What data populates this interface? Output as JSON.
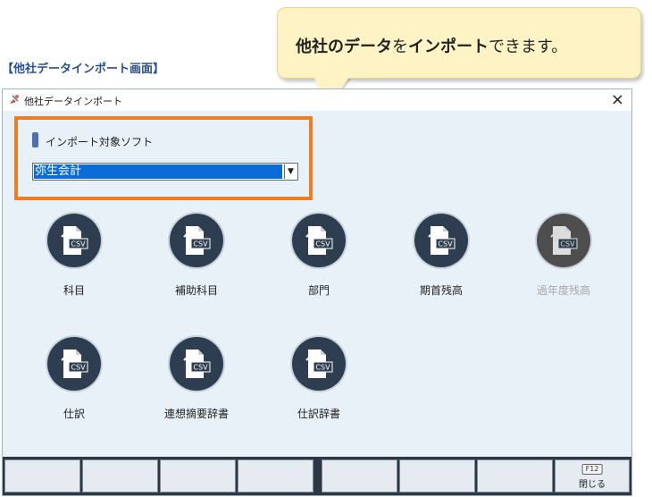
{
  "caption": "【他社データインポート画面】",
  "callout": {
    "bold1": "他社のデータ",
    "plain1": "を",
    "bold2": "インポート",
    "plain2": "できます。"
  },
  "window": {
    "title": "他社データインポート",
    "close": "×"
  },
  "soft": {
    "label": "インポート対象ソフト",
    "value": "弥生会計",
    "dropdown_icon": "▼"
  },
  "tiles": [
    {
      "label": "科目",
      "icon": "csv-file-icon",
      "enabled": true
    },
    {
      "label": "補助科目",
      "icon": "csv-file-icon",
      "enabled": true
    },
    {
      "label": "部門",
      "icon": "csv-file-icon",
      "enabled": true
    },
    {
      "label": "期首残高",
      "icon": "csv-file-icon",
      "enabled": true
    },
    {
      "label": "過年度残高",
      "icon": "csv-file-icon",
      "enabled": false
    },
    {
      "label": "仕訳",
      "icon": "csv-file-icon",
      "enabled": true
    },
    {
      "label": "連想摘要辞書",
      "icon": "csv-file-icon",
      "enabled": true
    },
    {
      "label": "仕訳辞書",
      "icon": "csv-file-icon",
      "enabled": true
    }
  ],
  "csv_text": "CSV",
  "fnkeys": [
    {
      "key": "",
      "label": ""
    },
    {
      "key": "",
      "label": ""
    },
    {
      "key": "",
      "label": ""
    },
    {
      "key": "",
      "label": ""
    },
    {
      "key": "",
      "label": ""
    },
    {
      "key": "",
      "label": ""
    },
    {
      "key": "",
      "label": ""
    },
    {
      "key": "",
      "label": ""
    },
    {
      "key": "F12",
      "label": "閉じる"
    }
  ],
  "colors": {
    "accent_border": "#ed7d20",
    "selection": "#0a6cd6",
    "tile_circle": "#2e3e50",
    "caption": "#2a4f8f"
  }
}
